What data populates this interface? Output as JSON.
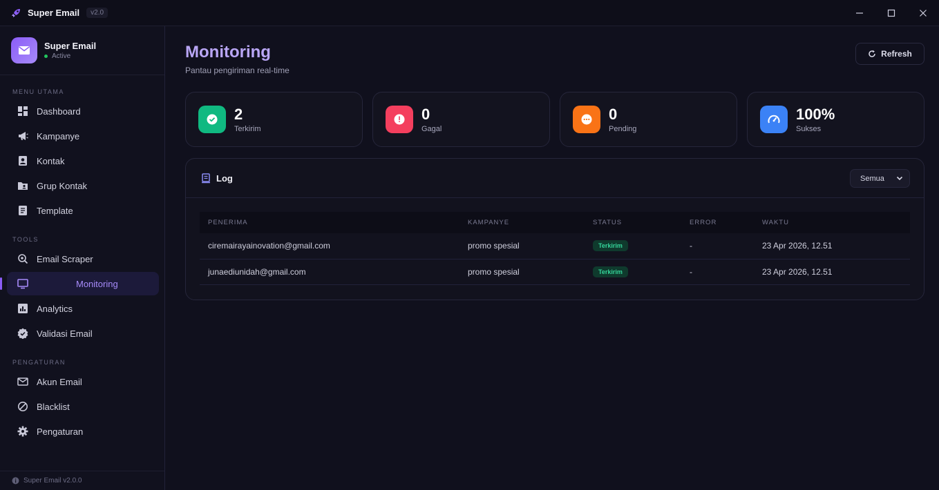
{
  "titlebar": {
    "app_name": "Super Email",
    "version": "v2.0"
  },
  "brand": {
    "name": "Super Email",
    "status": "Active"
  },
  "sidebar": {
    "sections": [
      {
        "label": "MENU UTAMA",
        "items": [
          {
            "label": "Dashboard",
            "icon": "dashboard-icon"
          },
          {
            "label": "Kampanye",
            "icon": "megaphone-icon"
          },
          {
            "label": "Kontak",
            "icon": "contact-icon"
          },
          {
            "label": "Grup Kontak",
            "icon": "folder-user-icon"
          },
          {
            "label": "Template",
            "icon": "document-icon"
          }
        ]
      },
      {
        "label": "TOOLS",
        "items": [
          {
            "label": "Email Scraper",
            "icon": "scraper-icon"
          },
          {
            "label": "Monitoring",
            "icon": "monitor-icon",
            "active": true
          },
          {
            "label": "Analytics",
            "icon": "chart-icon"
          },
          {
            "label": "Validasi Email",
            "icon": "verified-icon"
          }
        ]
      },
      {
        "label": "PENGATURAN",
        "items": [
          {
            "label": "Akun Email",
            "icon": "mail-icon"
          },
          {
            "label": "Blacklist",
            "icon": "block-icon"
          },
          {
            "label": "Pengaturan",
            "icon": "gear-icon"
          }
        ]
      }
    ],
    "footer": "Super Email v2.0.0"
  },
  "page": {
    "title": "Monitoring",
    "subtitle": "Pantau pengiriman real-time",
    "refresh_label": "Refresh"
  },
  "stats": [
    {
      "value": "2",
      "label": "Terkirim",
      "color": "#10b981"
    },
    {
      "value": "0",
      "label": "Gagal",
      "color": "#f43f5e"
    },
    {
      "value": "0",
      "label": "Pending",
      "color": "#f97316"
    },
    {
      "value": "100%",
      "label": "Sukses",
      "color": "#3b82f6"
    }
  ],
  "log": {
    "title": "Log",
    "filter": "Semua",
    "columns": [
      "PENERIMA",
      "KAMPANYE",
      "STATUS",
      "ERROR",
      "WAKTU"
    ],
    "rows": [
      {
        "recipient": "ciremairayainovation@gmail.com",
        "campaign": "promo spesial",
        "status": "Terkirim",
        "error": "-",
        "time": "23 Apr 2026, 12.51"
      },
      {
        "recipient": "junaediunidah@gmail.com",
        "campaign": "promo spesial",
        "status": "Terkirim",
        "error": "-",
        "time": "23 Apr 2026, 12.51"
      }
    ]
  },
  "colors": {
    "accent": "#8b5cf6",
    "success": "#34d399"
  }
}
